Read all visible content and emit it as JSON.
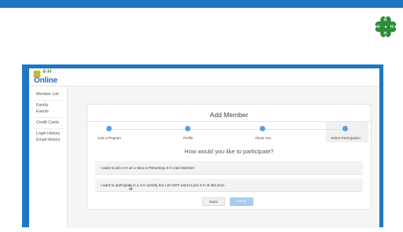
{
  "colors": {
    "brand_blue": "#1d77c4",
    "clover_green": "#2e8b3a",
    "step_blue": "#5aa0e2",
    "finish_button": "#a9ccee"
  },
  "app": {
    "logo_top": "4-H",
    "logo_bottom": "Online"
  },
  "sidebar": {
    "items": [
      {
        "label": "Member List"
      },
      {
        "label": "Family"
      },
      {
        "label": "Events"
      },
      {
        "label": "Credit Cards"
      },
      {
        "label": "Login History"
      },
      {
        "label": "Email History"
      }
    ]
  },
  "panel": {
    "title": "Add Member",
    "steps": [
      {
        "label": "Join a Program"
      },
      {
        "label": "Profile"
      },
      {
        "label": "About You"
      },
      {
        "label": "Select Participation"
      }
    ],
    "active_step": 4,
    "question": "How would you like to participate?",
    "options": [
      {
        "label": "I want to join 4-H as a New or Returning 4-H Club Member"
      },
      {
        "label": "I want to participate in a 4-H activity but I do NOT want to join 4-H at this time."
      }
    ],
    "back_label": "Back",
    "finish_label": "Finish"
  },
  "icons": {
    "header_logo": "4h-clover-icon",
    "app_logo": "4h-clover-icon",
    "cursor": "mouse-pointer-icon"
  }
}
